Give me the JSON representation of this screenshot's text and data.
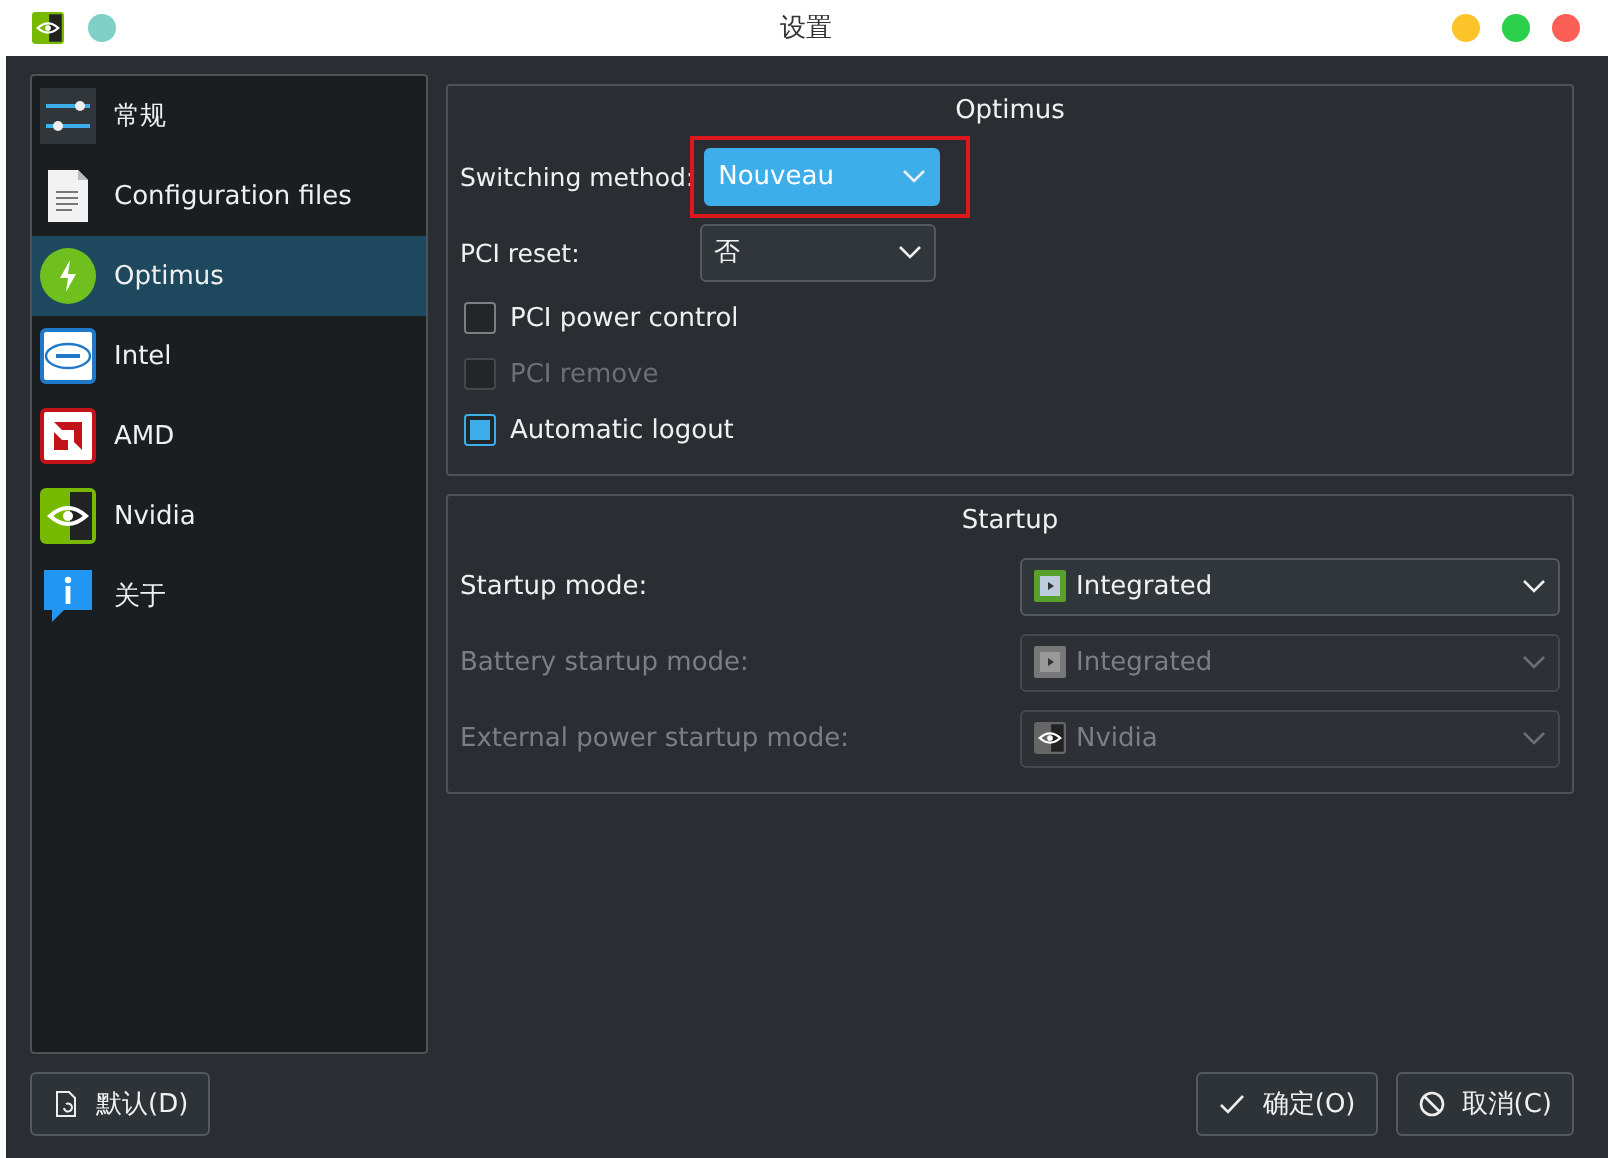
{
  "window": {
    "title": "设置"
  },
  "sidebar": {
    "items": [
      {
        "label": "常规",
        "kind": "sliders",
        "selected": false
      },
      {
        "label": "Configuration files",
        "kind": "document",
        "selected": false
      },
      {
        "label": "Optimus",
        "kind": "bolt",
        "selected": true
      },
      {
        "label": "Intel",
        "kind": "intel",
        "selected": false
      },
      {
        "label": "AMD",
        "kind": "amd",
        "selected": false
      },
      {
        "label": "Nvidia",
        "kind": "nvidia",
        "selected": false
      },
      {
        "label": "关于",
        "kind": "info",
        "selected": false
      }
    ]
  },
  "optimus": {
    "title": "Optimus",
    "fields": [
      {
        "label": "Switching method:",
        "value": "Nouveau",
        "focused": true,
        "highlighted": true
      },
      {
        "label": "PCI reset:",
        "value": "否",
        "focused": false,
        "highlighted": false
      }
    ],
    "checkboxes": [
      {
        "label": "PCI power control",
        "checked": false,
        "disabled": false
      },
      {
        "label": "PCI remove",
        "checked": false,
        "disabled": true
      },
      {
        "label": "Automatic logout",
        "checked": true,
        "disabled": false
      }
    ]
  },
  "startup": {
    "title": "Startup",
    "fields": [
      {
        "label": "Startup mode:",
        "value": "Integrated",
        "kind": "chip",
        "disabled": false
      },
      {
        "label": "Battery startup mode:",
        "value": "Integrated",
        "kind": "chip",
        "disabled": true
      },
      {
        "label": "External power startup mode:",
        "value": "Nvidia",
        "kind": "nvidia",
        "disabled": true
      }
    ]
  },
  "buttons": [
    {
      "label": "默认(D)",
      "kind": "document-reset"
    },
    {
      "label": "确定(O)",
      "kind": "check"
    },
    {
      "label": "取消(C)",
      "kind": "cancel"
    }
  ]
}
